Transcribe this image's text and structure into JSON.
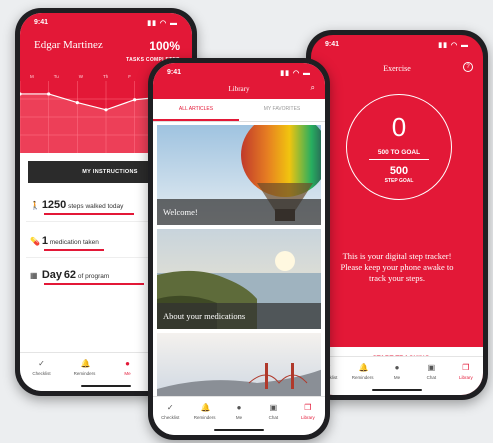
{
  "colors": {
    "accent": "#e31837",
    "dark": "#2b2b2b",
    "background": "#eceef0"
  },
  "phone1": {
    "time": "9:41",
    "user_name": "Edgar Martinez",
    "progress_percent": "100%",
    "progress_label": "TASKS COMPLETED",
    "days": [
      "M",
      "Tu",
      "W",
      "Th",
      "F",
      "Sa",
      "Su"
    ],
    "trend_values": [
      82,
      82,
      70,
      60,
      74,
      78,
      78
    ],
    "instructions_button": "MY INSTRUCTIONS",
    "steps": {
      "value": "1250",
      "label": "steps walked today"
    },
    "medication": {
      "value": "1",
      "label": "medication taken"
    },
    "program": {
      "prefix": "Day",
      "value": "62",
      "label": "of program"
    },
    "tabs": [
      {
        "label": "Checklist",
        "icon": "checkmark-icon"
      },
      {
        "label": "Reminders",
        "icon": "bell-icon"
      },
      {
        "label": "Me",
        "icon": "person-icon",
        "active": true
      },
      {
        "label": "Chat",
        "icon": "chat-icon"
      }
    ]
  },
  "phone2": {
    "time": "9:41",
    "title": "Library",
    "tab_all": "ALL ARTICLES",
    "tab_favorites": "MY FAVORITES",
    "articles": [
      {
        "title": "Welcome!"
      },
      {
        "title": "About your medications"
      },
      {
        "title": ""
      }
    ],
    "tabs": [
      {
        "label": "Checklist",
        "icon": "checkmark-icon"
      },
      {
        "label": "Reminders",
        "icon": "bell-icon"
      },
      {
        "label": "Me",
        "icon": "person-icon"
      },
      {
        "label": "Chat",
        "icon": "chat-icon"
      },
      {
        "label": "Library",
        "icon": "book-icon",
        "active": true
      }
    ]
  },
  "phone3": {
    "time": "9:41",
    "title": "Exercise",
    "count": "0",
    "goal_label": "500 TO GOAL",
    "step_goal": "500",
    "step_goal_label": "STEP GOAL",
    "message": "This is your digital step tracker! Please keep your phone awake to track your steps.",
    "button": "START TRACKING",
    "tabs": [
      {
        "label": "Checklist",
        "icon": "checkmark-icon"
      },
      {
        "label": "Reminders",
        "icon": "bell-icon"
      },
      {
        "label": "Me",
        "icon": "person-icon"
      },
      {
        "label": "Chat",
        "icon": "chat-icon"
      },
      {
        "label": "Library",
        "icon": "book-icon",
        "active": true
      }
    ]
  }
}
